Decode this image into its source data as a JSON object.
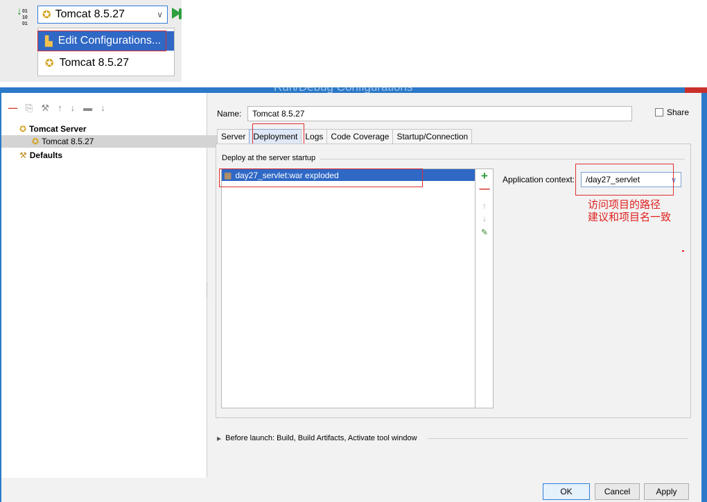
{
  "toolbar": {
    "run_config_label": "Tomcat 8.5.27",
    "dropdown_items": [
      "Edit Configurations...",
      "Tomcat 8.5.27"
    ]
  },
  "dialog": {
    "title": "Run/Debug Configurations",
    "tree": {
      "group_label": "Tomcat Server",
      "child_label": "Tomcat 8.5.27",
      "defaults_label": "Defaults"
    },
    "name_label": "Name:",
    "name_value": "Tomcat 8.5.27",
    "share_label": "Share",
    "tabs": [
      "Server",
      "Deployment",
      "Logs",
      "Code Coverage",
      "Startup/Connection"
    ],
    "active_tab": "Deployment",
    "deploy_group_label": "Deploy at the server startup",
    "artifact_label": "day27_servlet:war exploded",
    "app_context_label": "Application context:",
    "app_context_value": "/day27_servlet",
    "annotation_lines": [
      "访问项目的路径",
      "建议和项目名一致"
    ],
    "before_launch_label": "Before launch: Build, Build Artifacts, Activate tool window",
    "buttons": {
      "ok": "OK",
      "cancel": "Cancel",
      "apply": "Apply"
    }
  },
  "colors": {
    "selection": "#2f68c5",
    "annotation_red": "#e02020",
    "title_bar": "#2b79c8",
    "add_green": "#2e9e3e",
    "remove_red": "#d0332b"
  }
}
